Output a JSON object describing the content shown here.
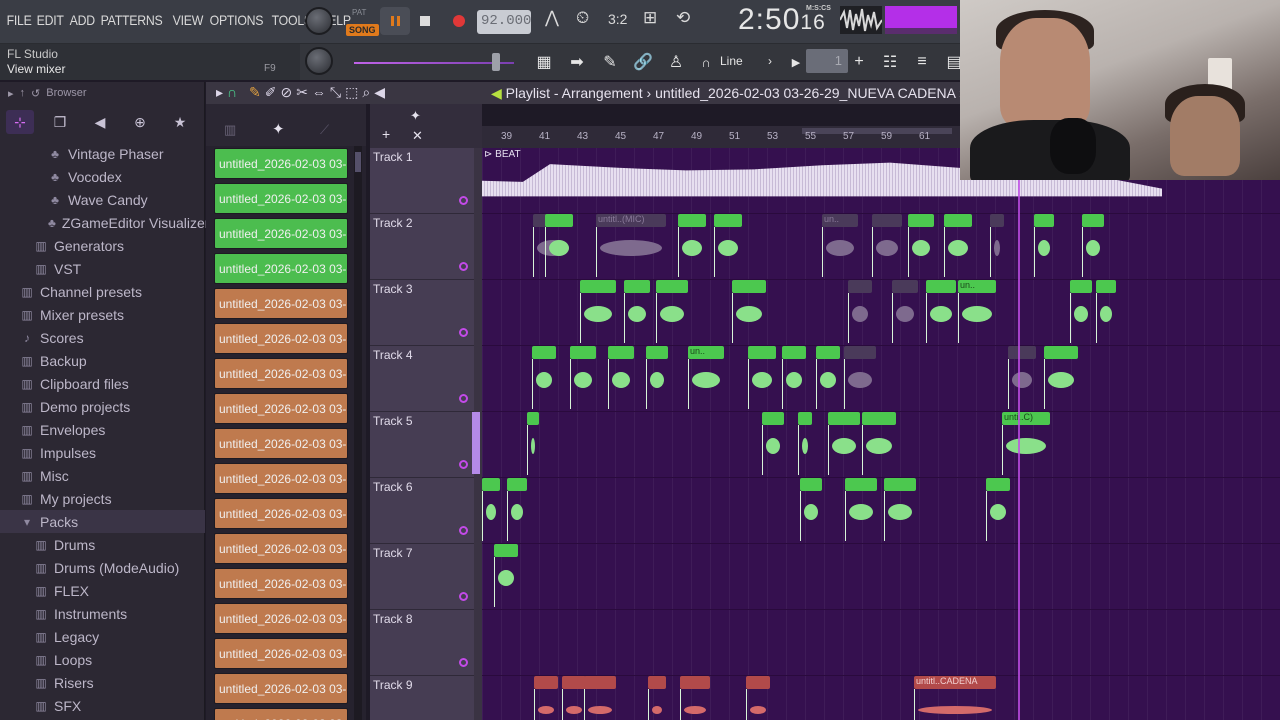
{
  "menu": [
    "FILE",
    "EDIT",
    "ADD",
    "PATTERNS",
    "VIEW",
    "OPTIONS",
    "TOOLS",
    "HELP"
  ],
  "transport": {
    "pat_label": "PAT",
    "song_label": "SONG",
    "tempo": "92.000"
  },
  "clock": {
    "main": "2:50",
    "sub": "16",
    "unit": "M:S:CS"
  },
  "hint": {
    "title": "FL Studio",
    "text": "View mixer",
    "key": "F9"
  },
  "toolbar2": {
    "snap": "Line",
    "pattern": "1"
  },
  "browser": {
    "label": "Browser",
    "items": [
      {
        "label": "Vintage Phaser",
        "level": 2,
        "icon": "plugin-icon"
      },
      {
        "label": "Vocodex",
        "level": 2,
        "icon": "plugin-icon"
      },
      {
        "label": "Wave Candy",
        "level": 2,
        "icon": "plugin-icon"
      },
      {
        "label": "ZGameEditor Visualizer",
        "level": 2,
        "icon": "plugin-icon"
      },
      {
        "label": "Generators",
        "level": 1,
        "icon": "folder-icon"
      },
      {
        "label": "VST",
        "level": 1,
        "icon": "folder-icon"
      },
      {
        "label": "Channel presets",
        "level": 0,
        "icon": "folder-icon"
      },
      {
        "label": "Mixer presets",
        "level": 0,
        "icon": "folder-icon"
      },
      {
        "label": "Scores",
        "level": 0,
        "icon": "note-icon"
      },
      {
        "label": "Backup",
        "level": 0,
        "icon": "folder-icon"
      },
      {
        "label": "Clipboard files",
        "level": 0,
        "icon": "folder-icon"
      },
      {
        "label": "Demo projects",
        "level": 0,
        "icon": "folder-icon"
      },
      {
        "label": "Envelopes",
        "level": 0,
        "icon": "folder-icon"
      },
      {
        "label": "Impulses",
        "level": 0,
        "icon": "folder-icon"
      },
      {
        "label": "Misc",
        "level": 0,
        "icon": "folder-icon"
      },
      {
        "label": "My projects",
        "level": 0,
        "icon": "folder-icon"
      },
      {
        "label": "Packs",
        "level": 0,
        "icon": "folder-open-icon"
      },
      {
        "label": "Drums",
        "level": 1,
        "icon": "folder-icon"
      },
      {
        "label": "Drums (ModeAudio)",
        "level": 1,
        "icon": "folder-icon"
      },
      {
        "label": "FLEX",
        "level": 1,
        "icon": "folder-icon"
      },
      {
        "label": "Instruments",
        "level": 1,
        "icon": "folder-icon"
      },
      {
        "label": "Legacy",
        "level": 1,
        "icon": "folder-icon"
      },
      {
        "label": "Loops",
        "level": 1,
        "icon": "folder-icon"
      },
      {
        "label": "Risers",
        "level": 1,
        "icon": "folder-icon"
      },
      {
        "label": "SFX",
        "level": 1,
        "icon": "folder-icon"
      }
    ]
  },
  "picker": {
    "clips": [
      {
        "label": "untitled_2026-02-03 03-...",
        "color": "green"
      },
      {
        "label": "untitled_2026-02-03 03-...",
        "color": "green"
      },
      {
        "label": "untitled_2026-02-03 03-...",
        "color": "green"
      },
      {
        "label": "untitled_2026-02-03 03-...",
        "color": "green"
      },
      {
        "label": "untitled_2026-02-03 03-...",
        "color": "orange"
      },
      {
        "label": "untitled_2026-02-03 03-...",
        "color": "orange"
      },
      {
        "label": "untitled_2026-02-03 03-...",
        "color": "orange"
      },
      {
        "label": "untitled_2026-02-03 03-...",
        "color": "orange"
      },
      {
        "label": "untitled_2026-02-03 03-...",
        "color": "orange"
      },
      {
        "label": "untitled_2026-02-03 03-...",
        "color": "orange"
      },
      {
        "label": "untitled_2026-02-03 03-...",
        "color": "orange"
      },
      {
        "label": "untitled_2026-02-03 03-...",
        "color": "orange"
      },
      {
        "label": "untitled_2026-02-03 03-...",
        "color": "orange"
      },
      {
        "label": "untitled_2026-02-03 03-...",
        "color": "orange"
      },
      {
        "label": "untitled_2026-02-03 03-...",
        "color": "orange"
      },
      {
        "label": "untitled_2026-02-03 03-...",
        "color": "orange"
      },
      {
        "label": "untitled_2026-02-03 03-...",
        "color": "orange"
      }
    ]
  },
  "playlist": {
    "title": "Playlist - Arrangement",
    "project": "untitled_2026-02-03 03-26-29_NUEVA CADENA",
    "ticks": [
      "39",
      "41",
      "43",
      "45",
      "47",
      "49",
      "51",
      "53",
      "55",
      "57",
      "59",
      "61"
    ],
    "beat_label": "BEAT",
    "tracks": [
      "Track 1",
      "Track 2",
      "Track 3",
      "Track 4",
      "Track 5",
      "Track 6",
      "Track 7",
      "Track 8",
      "Track 9"
    ],
    "clip_labels": {
      "t2_mic": "untitl..(MIC)",
      "t2_un": "un..",
      "t3_un": "un..",
      "t4_un": "un..",
      "t5": "unti..C)",
      "t9": "untitl..CADENA"
    }
  },
  "colors": {
    "accent": "#c24de8",
    "clip_green": "#4cc84f",
    "clip_orange": "#bf7a4e",
    "grid": "#35104f"
  }
}
